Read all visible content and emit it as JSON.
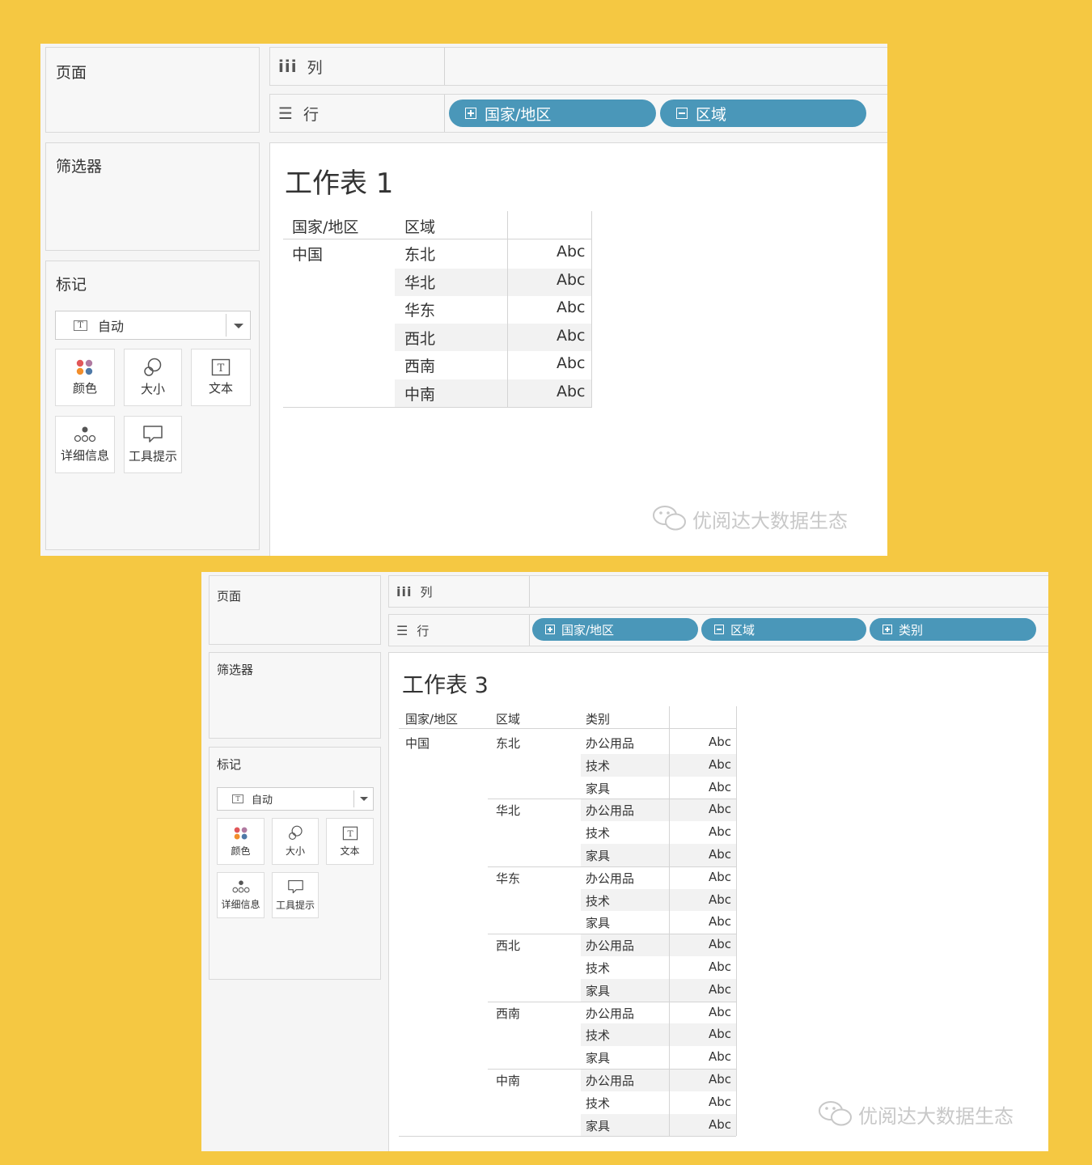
{
  "colors": {
    "background": "#f5c842",
    "pill": "#4a97b9",
    "band": "#f2f2f2"
  },
  "panels": [
    {
      "pages_label": "页面",
      "filters_label": "筛选器",
      "marks_label": "标记",
      "marks_dropdown": "自动",
      "marks_buttons": {
        "color": "颜色",
        "size": "大小",
        "text": "文本",
        "detail": "详细信息",
        "tooltip": "工具提示"
      },
      "columns_label": "列",
      "rows_label": "行",
      "row_pills": [
        {
          "icon": "plus",
          "label": "国家/地区"
        },
        {
          "icon": "minus",
          "label": "区域"
        }
      ],
      "sheet_title": "工作表 1",
      "table": {
        "headers": [
          "国家/地区",
          "区域"
        ],
        "country": "中国",
        "regions": [
          "东北",
          "华北",
          "华东",
          "西北",
          "西南",
          "中南"
        ],
        "values": [
          "Abc",
          "Abc",
          "Abc",
          "Abc",
          "Abc",
          "Abc"
        ]
      },
      "watermark": "优阅达大数据生态"
    },
    {
      "pages_label": "页面",
      "filters_label": "筛选器",
      "marks_label": "标记",
      "marks_dropdown": "自动",
      "marks_buttons": {
        "color": "颜色",
        "size": "大小",
        "text": "文本",
        "detail": "详细信息",
        "tooltip": "工具提示"
      },
      "columns_label": "列",
      "rows_label": "行",
      "row_pills": [
        {
          "icon": "plus",
          "label": "国家/地区"
        },
        {
          "icon": "minus",
          "label": "区域"
        },
        {
          "icon": "plus",
          "label": "类别"
        }
      ],
      "sheet_title": "工作表 3",
      "table": {
        "headers": [
          "国家/地区",
          "区域",
          "类别"
        ],
        "country": "中国",
        "regions": [
          "东北",
          "华北",
          "华东",
          "西北",
          "西南",
          "中南"
        ],
        "categories": [
          "办公用品",
          "技术",
          "家具"
        ],
        "value": "Abc"
      },
      "watermark": "优阅达大数据生态"
    }
  ]
}
